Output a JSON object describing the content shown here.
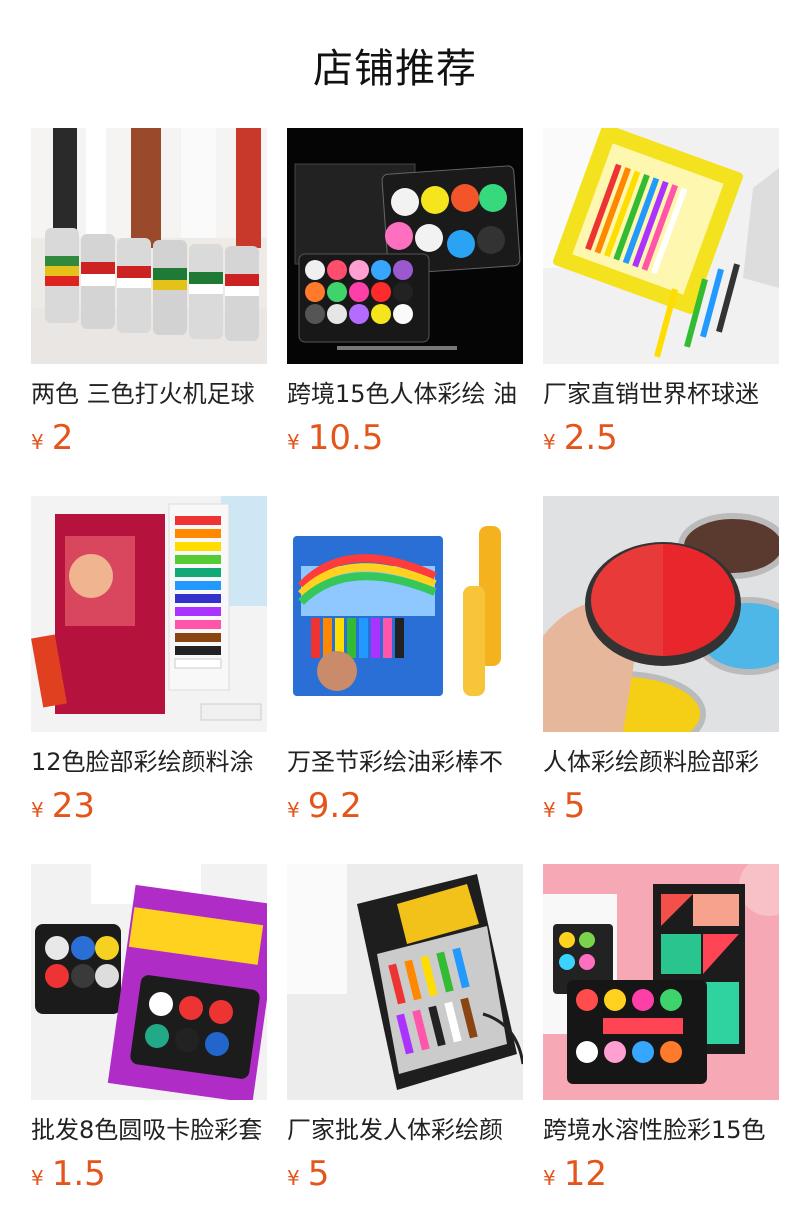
{
  "header": {
    "title": "店铺推荐"
  },
  "products": [
    {
      "name": "两色 三色打火机足球",
      "currency": "¥",
      "price": "2",
      "image_icon": "face-paint-sticks-image"
    },
    {
      "name": "跨境15色人体彩绘 油",
      "currency": "¥",
      "price": "10.5",
      "image_icon": "face-paint-palette-image"
    },
    {
      "name": "厂家直销世界杯球迷",
      "currency": "¥",
      "price": "2.5",
      "image_icon": "face-crayons-pack-image"
    },
    {
      "name": "12色脸部彩绘颜料涂",
      "currency": "¥",
      "price": "23",
      "image_icon": "body-paint-tubes-image"
    },
    {
      "name": "万圣节彩绘油彩棒不",
      "currency": "¥",
      "price": "9.2",
      "image_icon": "face-paint-crayons-box-image"
    },
    {
      "name": "人体彩绘颜料脸部彩",
      "currency": "¥",
      "price": "5",
      "image_icon": "face-paint-pots-image"
    },
    {
      "name": "批发8色圆吸卡脸彩套",
      "currency": "¥",
      "price": "1.5",
      "image_icon": "face-paints-card-image"
    },
    {
      "name": "厂家批发人体彩绘颜",
      "currency": "¥",
      "price": "5",
      "image_icon": "crayons-blister-pack-image"
    },
    {
      "name": "跨境水溶性脸彩15色",
      "currency": "¥",
      "price": "12",
      "image_icon": "water-based-palette-image"
    }
  ]
}
